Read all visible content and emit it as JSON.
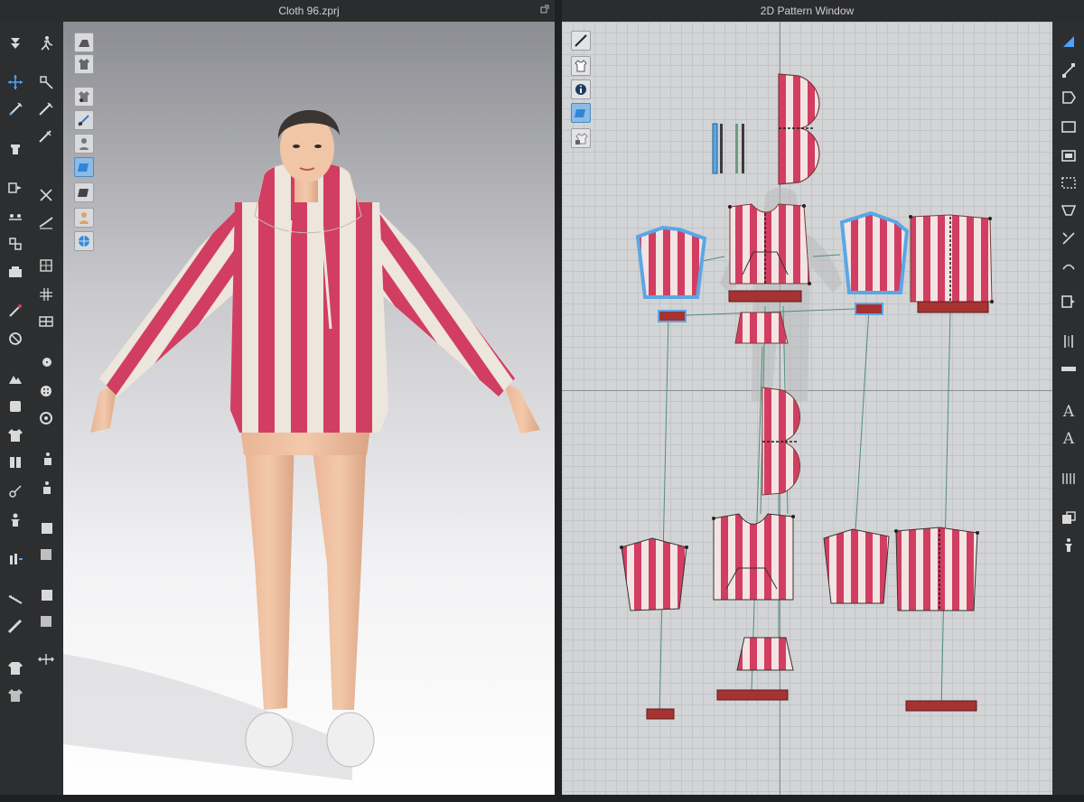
{
  "viewport3d": {
    "title": "Cloth 96.zprj"
  },
  "pattern_window": {
    "title": "2D Pattern Window"
  },
  "right_toolbar": {
    "text_tool_a": "A",
    "text_tool_b": "A"
  },
  "colors": {
    "stripe_red": "#d23e62",
    "stripe_cream": "#ece6dc",
    "selection_blue": "#5aa7e6",
    "sewing_line": "#3f8a6e",
    "band_dark": "#a63232"
  }
}
